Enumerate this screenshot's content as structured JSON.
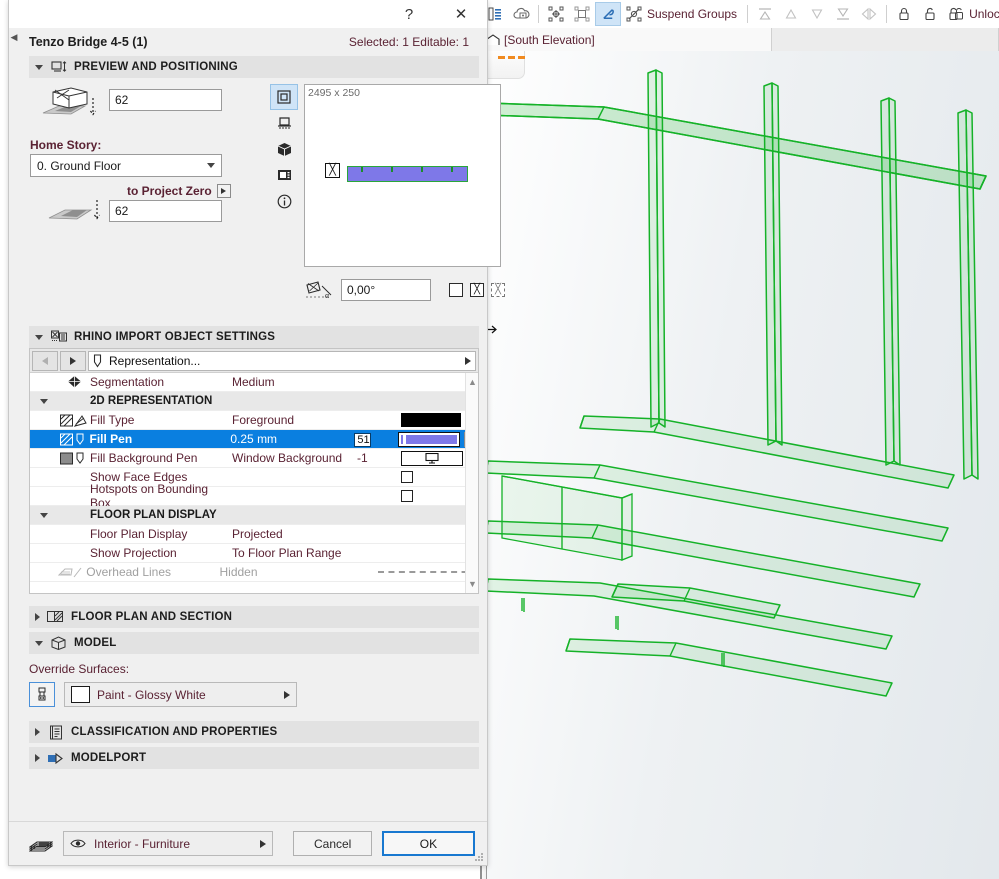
{
  "app": {
    "toolbar": {
      "items": [
        {
          "name": "layers-panel-icon",
          "glyph": "icon-layers"
        },
        {
          "name": "cloud-info-icon",
          "glyph": "icon-cloud"
        },
        {
          "name": "group-icon",
          "glyph": "icon-group"
        },
        {
          "name": "ungroup-icon",
          "glyph": "icon-ungroup"
        },
        {
          "name": "edit-group-icon",
          "glyph": "icon-editgroup",
          "active": true
        },
        {
          "name": "suspend-groups-icon",
          "glyph": "icon-suspend"
        }
      ],
      "suspend_groups_label": "Suspend Groups",
      "order_items": [
        {
          "name": "bring-to-front-icon"
        },
        {
          "name": "bring-forward-icon"
        },
        {
          "name": "send-backward-icon"
        },
        {
          "name": "send-to-back-icon"
        },
        {
          "name": "order-default-icon"
        }
      ],
      "lock_items": [
        {
          "name": "lock-icon"
        },
        {
          "name": "unlock-icon"
        },
        {
          "name": "unlock-all-icon"
        }
      ],
      "unlock_all_label": "Unlock All"
    },
    "tabs": [
      {
        "label": "[South Elevation]",
        "icon": "home-icon",
        "active": true
      },
      {
        "label": "",
        "icon": "",
        "active": false
      }
    ]
  },
  "dialog": {
    "titlebar": {
      "help_label": "?",
      "close_label": "✕"
    },
    "title": "Tenzo Bridge 4-5 (1)",
    "selection_status": "Selected: 1 Editable: 1",
    "preview_section": {
      "title": "PREVIEW AND POSITIONING",
      "expanded": true,
      "icon": "preview-positioning-icon",
      "elevation_top_value": "62",
      "home_story_label": "Home Story:",
      "home_story_value": "0. Ground Floor",
      "to_project_zero_label": "to Project Zero",
      "elevation_bottom_value": "62",
      "preview_modes": [
        {
          "name": "preview-mode-2d-symbol",
          "icon": "square-icon",
          "selected": true
        },
        {
          "name": "preview-mode-plan",
          "icon": "plan-icon",
          "selected": false
        },
        {
          "name": "preview-mode-3d",
          "icon": "cube-icon",
          "selected": false
        },
        {
          "name": "preview-mode-section",
          "icon": "section-icon",
          "selected": false
        },
        {
          "name": "preview-mode-info",
          "icon": "info-icon",
          "selected": false
        }
      ],
      "preview_dimensions": "2495 x 250",
      "rotation_label": "rotation-angle-icon",
      "rotation_value": "0,00°",
      "mirror_buttons": [
        {
          "name": "mirror-none-button",
          "style": "plain-empty"
        },
        {
          "name": "mirror-x-button",
          "style": "boxed-x"
        },
        {
          "name": "mirror-dashed-button",
          "style": "dashed-x"
        }
      ]
    },
    "rhino_section": {
      "title": "RHINO IMPORT OBJECT SETTINGS",
      "expanded": true,
      "icon": "rhino-import-icon",
      "nav": {
        "back_label": "back-arrow",
        "forward_label": "forward-arrow",
        "field_icon": "pen-icon",
        "field_label": "Representation...",
        "end_arrow": "forward-arrow"
      },
      "rows": [
        {
          "type": "item",
          "icon": "segmentation-icon",
          "name": "Segmentation",
          "value": "Medium",
          "num": "",
          "swatch": "none"
        },
        {
          "type": "group",
          "name": "2D REPRESENTATION",
          "expanded": true
        },
        {
          "type": "item",
          "icon": "fill-type-icon",
          "name": "Fill Type",
          "value": "Foreground",
          "num": "",
          "swatch": "black"
        },
        {
          "type": "item",
          "icon": "fill-pen-icon",
          "name": "Fill Pen",
          "value": "0.25 mm",
          "num": "51",
          "swatch": "pen",
          "selected": true
        },
        {
          "type": "item",
          "icon": "fill-bg-pen-icon",
          "name": "Fill Background Pen",
          "value": "Window Background",
          "num": "-1",
          "swatch": "screen"
        },
        {
          "type": "item",
          "icon": "",
          "name": "Show Face Edges",
          "value": "",
          "num": "",
          "swatch": "checkbox",
          "checked": false
        },
        {
          "type": "item",
          "icon": "",
          "name": "Hotspots on Bounding Box",
          "value": "",
          "num": "",
          "swatch": "checkbox",
          "checked": false
        },
        {
          "type": "group",
          "name": "FLOOR PLAN DISPLAY",
          "expanded": true
        },
        {
          "type": "item",
          "icon": "",
          "name": "Floor Plan Display",
          "value": "Projected",
          "num": "",
          "swatch": "none"
        },
        {
          "type": "item",
          "icon": "",
          "name": "Show Projection",
          "value": "To Floor Plan Range",
          "num": "",
          "swatch": "none"
        },
        {
          "type": "item",
          "icon": "overhead-lines-icon",
          "name": "Overhead Lines",
          "value": "Hidden",
          "num": "",
          "swatch": "dashline",
          "disabled": true
        }
      ]
    },
    "collapsed_sections": [
      {
        "title": "FLOOR PLAN AND SECTION",
        "icon": "floorplan-section-icon",
        "expanded": false
      },
      {
        "title": "CLASSIFICATION AND PROPERTIES",
        "icon": "classification-icon",
        "expanded": false
      },
      {
        "title": "MODELPORT",
        "icon": "modelport-icon",
        "expanded": false
      }
    ],
    "model_section": {
      "title": "MODEL",
      "icon": "model-cube-icon",
      "expanded": true,
      "override_label": "Override Surfaces:",
      "paint_button_icon": "paintbrush-icon",
      "material_value": "Paint - Glossy White"
    },
    "footer": {
      "layer_icon": "layers-stack-icon",
      "layer_eye_icon": "eye-icon",
      "layer_value": "Interior - Furniture",
      "cancel_label": "Cancel",
      "ok_label": "OK"
    }
  },
  "colors": {
    "accent_blue": "#0a7fe0",
    "ok_border": "#1878d0",
    "label_maroon": "#5a2233",
    "pen_purple": "#7e78e8",
    "model_green": "#18b82c",
    "tab_orange": "#f08a20"
  },
  "viewport": {
    "model_name": "shelving-wireframe-3d",
    "cursor": "horizontal-resize-cursor"
  }
}
